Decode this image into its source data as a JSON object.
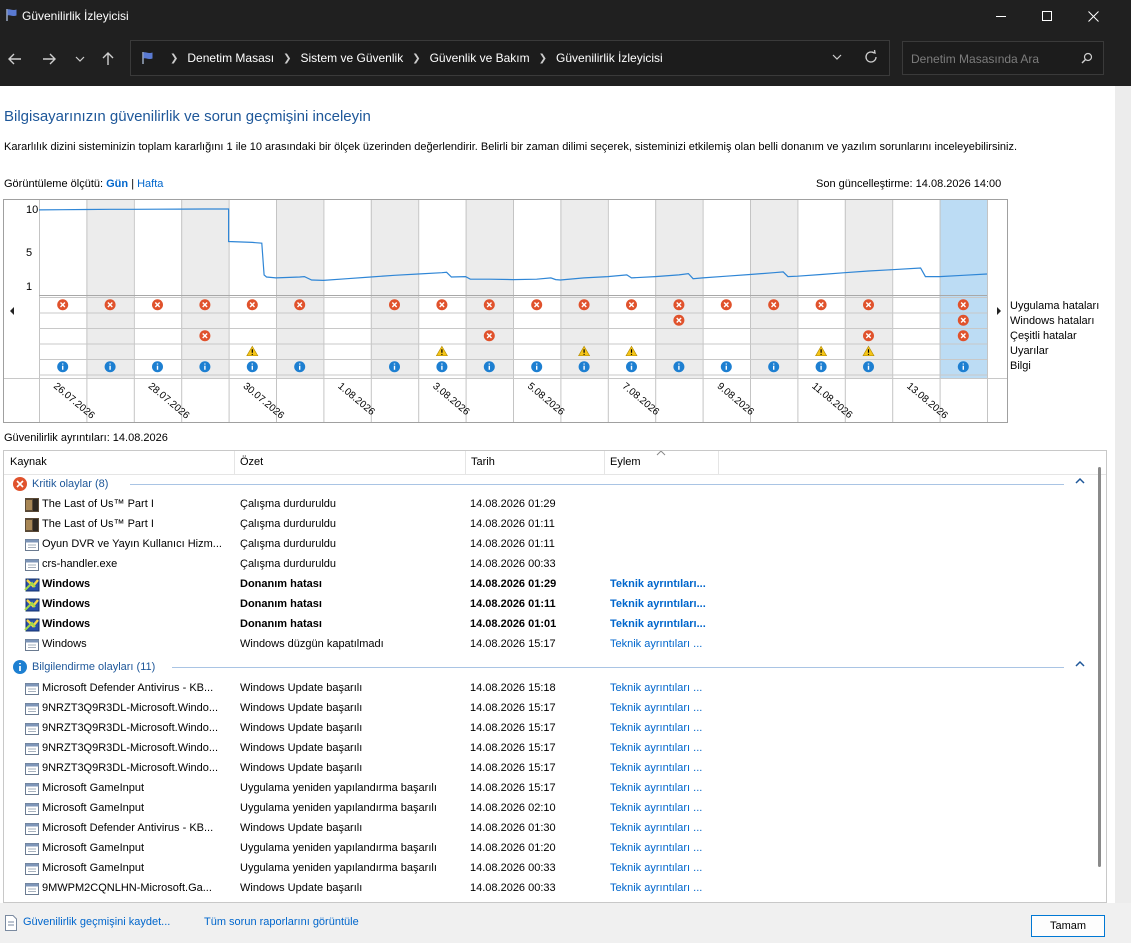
{
  "window": {
    "title": "Güvenilirlik İzleyicisi"
  },
  "address": {
    "crumbs": [
      "Denetim Masası",
      "Sistem ve Güvenlik",
      "Güvenlik ve Bakım",
      "Güvenilirlik İzleyicisi"
    ]
  },
  "search": {
    "placeholder": "Denetim Masasında Ara"
  },
  "page": {
    "heading": "Bilgisayarınızın güvenilirlik ve sorun geçmişini inceleyin",
    "description": "Kararlılık dizini sisteminizin toplam kararlığını 1 ile 10 arasındaki bir ölçek üzerinden değerlendirir. Belirli bir zaman dilimi seçerek, sisteminizi etkilemiş olan belli donanım ve yazılım sorunlarını inceleyebilirsiniz.",
    "view_by_label": "Görüntüleme ölçütü:",
    "view_day": "Gün",
    "view_sep": "|",
    "view_week": "Hafta",
    "last_update": "Son güncelleştirme: 14.08.2026 14:00",
    "details_label": "Güvenilirlik ayrıntıları: 14.08.2026"
  },
  "chart_data": {
    "type": "line",
    "y_ticks": [
      "10",
      "5",
      "1"
    ],
    "ylim": [
      1,
      10
    ],
    "date_labels": [
      "26.07.2026",
      "28.07.2026",
      "30.07.2026",
      "1.08.2026",
      "3.08.2026",
      "5.08.2026",
      "7.08.2026",
      "9.08.2026",
      "11.08.2026",
      "13.08.2026"
    ],
    "row_labels": [
      "Uygulama hataları",
      "Windows hataları",
      "Çeşitli hatalar",
      "Uyarılar",
      "Bilgi"
    ],
    "columns": 20,
    "selected_column": 19,
    "shaded_columns": [
      1,
      3,
      5,
      7,
      9,
      11,
      13,
      15,
      17
    ],
    "stability_index": [
      [
        0,
        9.9
      ],
      [
        0.5,
        9.92
      ],
      [
        1,
        9.94
      ],
      [
        1.5,
        9.96
      ],
      [
        2,
        9.97
      ],
      [
        2.5,
        9.98
      ],
      [
        3,
        9.99
      ],
      [
        3.5,
        10.0
      ],
      [
        4,
        10.0
      ],
      [
        4,
        6.2
      ],
      [
        4.5,
        6.1
      ],
      [
        4.7,
        6.0
      ],
      [
        4.75,
        2.3
      ],
      [
        4.8,
        2.05
      ],
      [
        5,
        1.95
      ],
      [
        5.5,
        2.05
      ],
      [
        5.6,
        2.1
      ],
      [
        5.75,
        1.7
      ],
      [
        6,
        1.65
      ],
      [
        6.5,
        1.85
      ],
      [
        7,
        2.05
      ],
      [
        7.5,
        2.25
      ],
      [
        8,
        2.4
      ],
      [
        8.5,
        2.55
      ],
      [
        8.6,
        2.6
      ],
      [
        8.7,
        2.05
      ],
      [
        9,
        2.1
      ],
      [
        9.1,
        1.8
      ],
      [
        9.5,
        1.8
      ],
      [
        10,
        1.75
      ],
      [
        10.5,
        1.8
      ],
      [
        10.8,
        1.95
      ],
      [
        10.9,
        1.75
      ],
      [
        11,
        1.7
      ],
      [
        11.5,
        1.95
      ],
      [
        12,
        2.1
      ],
      [
        12.4,
        2.3
      ],
      [
        12.5,
        1.95
      ],
      [
        13,
        2.1
      ],
      [
        13.5,
        2.3
      ],
      [
        13.7,
        2.45
      ],
      [
        13.8,
        1.85
      ],
      [
        14,
        1.95
      ],
      [
        14.5,
        2.15
      ],
      [
        15,
        2.35
      ],
      [
        15.5,
        2.55
      ],
      [
        15.7,
        2.65
      ],
      [
        15.8,
        2.1
      ],
      [
        16,
        2.15
      ],
      [
        16.5,
        2.35
      ],
      [
        17,
        2.55
      ],
      [
        17.5,
        2.75
      ],
      [
        18,
        2.9
      ],
      [
        18.6,
        3.1
      ],
      [
        18.7,
        2.1
      ],
      [
        19,
        2.1
      ],
      [
        19.5,
        2.25
      ],
      [
        20,
        2.4
      ]
    ],
    "app_failures": [
      0,
      1,
      2,
      3,
      4,
      5,
      7,
      8,
      9,
      10,
      11,
      12,
      13,
      14,
      15,
      16,
      17,
      19
    ],
    "windows_failures": [
      13,
      19
    ],
    "misc_failures": [
      3,
      9,
      17,
      19
    ],
    "warnings": [
      4,
      8,
      11,
      12,
      16,
      17
    ],
    "info": [
      0,
      1,
      2,
      3,
      4,
      5,
      7,
      8,
      9,
      10,
      11,
      12,
      13,
      14,
      15,
      16,
      17,
      19
    ]
  },
  "table": {
    "headers": [
      "Kaynak",
      "Özet",
      "Tarih",
      "Eylem"
    ],
    "critical_group": "Kritik olaylar (8)",
    "info_group": "Bilgilendirme olayları (11)",
    "critical_rows": [
      {
        "icon": "game",
        "source": "The Last of Us™ Part I",
        "summary": "Çalışma durduruldu",
        "date": "14.08.2026 01:29",
        "action": "",
        "bold": false
      },
      {
        "icon": "game",
        "source": "The Last of Us™ Part I",
        "summary": "Çalışma durduruldu",
        "date": "14.08.2026 01:11",
        "action": "",
        "bold": false
      },
      {
        "icon": "app",
        "source": "Oyun DVR ve Yayın Kullanıcı Hizm...",
        "summary": "Çalışma durduruldu",
        "date": "14.08.2026 01:11",
        "action": "",
        "bold": false
      },
      {
        "icon": "app",
        "source": "crs-handler.exe",
        "summary": "Çalışma durduruldu",
        "date": "14.08.2026 00:33",
        "action": "",
        "bold": false
      },
      {
        "icon": "hardware",
        "source": "Windows",
        "summary": "Donanım hatası",
        "date": "14.08.2026 01:29",
        "action": "Teknik ayrıntıları...",
        "bold": true
      },
      {
        "icon": "hardware",
        "source": "Windows",
        "summary": "Donanım hatası",
        "date": "14.08.2026 01:11",
        "action": "Teknik ayrıntıları...",
        "bold": true
      },
      {
        "icon": "hardware",
        "source": "Windows",
        "summary": "Donanım hatası",
        "date": "14.08.2026 01:01",
        "action": "Teknik ayrıntıları...",
        "bold": true
      },
      {
        "icon": "app",
        "source": "Windows",
        "summary": "Windows düzgün kapatılmadı",
        "date": "14.08.2026 15:17",
        "action": "Teknik ayrıntıları ...",
        "bold": false
      }
    ],
    "info_rows": [
      {
        "source": "Microsoft Defender Antivirus - KB...",
        "summary": "Windows Update başarılı",
        "date": "14.08.2026 15:18",
        "action": "Teknik ayrıntıları ..."
      },
      {
        "source": "9NRZT3Q9R3DL-Microsoft.Windo...",
        "summary": "Windows Update başarılı",
        "date": "14.08.2026 15:17",
        "action": "Teknik ayrıntıları ..."
      },
      {
        "source": "9NRZT3Q9R3DL-Microsoft.Windo...",
        "summary": "Windows Update başarılı",
        "date": "14.08.2026 15:17",
        "action": "Teknik ayrıntıları ..."
      },
      {
        "source": "9NRZT3Q9R3DL-Microsoft.Windo...",
        "summary": "Windows Update başarılı",
        "date": "14.08.2026 15:17",
        "action": "Teknik ayrıntıları ..."
      },
      {
        "source": "9NRZT3Q9R3DL-Microsoft.Windo...",
        "summary": "Windows Update başarılı",
        "date": "14.08.2026 15:17",
        "action": "Teknik ayrıntıları ..."
      },
      {
        "source": "Microsoft GameInput",
        "summary": "Uygulama yeniden yapılandırma başarılı",
        "date": "14.08.2026 15:17",
        "action": "Teknik ayrıntıları ..."
      },
      {
        "source": "Microsoft GameInput",
        "summary": "Uygulama yeniden yapılandırma başarılı",
        "date": "14.08.2026 02:10",
        "action": "Teknik ayrıntıları ..."
      },
      {
        "source": "Microsoft Defender Antivirus - KB...",
        "summary": "Windows Update başarılı",
        "date": "14.08.2026 01:30",
        "action": "Teknik ayrıntıları ..."
      },
      {
        "source": "Microsoft GameInput",
        "summary": "Uygulama yeniden yapılandırma başarılı",
        "date": "14.08.2026 01:20",
        "action": "Teknik ayrıntıları ..."
      },
      {
        "source": "Microsoft GameInput",
        "summary": "Uygulama yeniden yapılandırma başarılı",
        "date": "14.08.2026 00:33",
        "action": "Teknik ayrıntıları ..."
      },
      {
        "source": "9MWPM2CQNLHN-Microsoft.Ga...",
        "summary": "Windows Update başarılı",
        "date": "14.08.2026 00:33",
        "action": "Teknik ayrıntıları ..."
      }
    ]
  },
  "footer": {
    "save_link": "Güvenilirlik geçmişini kaydet...",
    "all_reports_link": "Tüm sorun raporlarını görüntüle",
    "ok_button": "Tamam"
  },
  "colors": {
    "accent_blue": "#1e5799",
    "link_blue": "#0066cc",
    "line_blue": "#2f86d6",
    "error_red": "#e0522c",
    "warning_yellow": "#f5c518",
    "info_blue": "#1d7fd1",
    "selected_column": "#bcdcf4",
    "shaded_column": "#ececec"
  },
  "icons": {
    "app_icon": "flag-icon",
    "back": "back-arrow-icon",
    "forward": "forward-arrow-icon",
    "up": "up-arrow-icon",
    "recent": "chevron-down-icon",
    "refresh": "refresh-icon",
    "search": "search-icon"
  }
}
